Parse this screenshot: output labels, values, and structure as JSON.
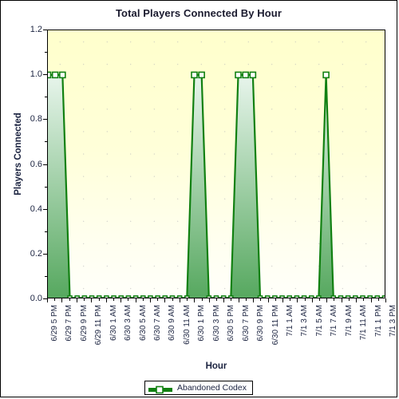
{
  "chart_data": {
    "type": "line",
    "title": "Total Players Connected By Hour",
    "xlabel": "Hour",
    "ylabel": "Players Connected",
    "ylim": [
      0.0,
      1.2
    ],
    "yticks": [
      "0.0",
      "0.2",
      "0.4",
      "0.6",
      "0.8",
      "1.0",
      "1.2"
    ],
    "ytick_values": [
      0.0,
      0.2,
      0.4,
      0.6,
      0.8,
      1.0,
      1.2
    ],
    "grid": true,
    "legend_position": "bottom",
    "categories": [
      "6/29 5 PM",
      "6/29 6 PM",
      "6/29 7 PM",
      "6/29 8 PM",
      "6/29 9 PM",
      "6/29 10 PM",
      "6/29 11 PM",
      "6/30 12 AM",
      "6/30 1 AM",
      "6/30 2 AM",
      "6/30 3 AM",
      "6/30 4 AM",
      "6/30 5 AM",
      "6/30 6 AM",
      "6/30 7 AM",
      "6/30 8 AM",
      "6/30 9 AM",
      "6/30 10 AM",
      "6/30 11 AM",
      "6/30 12 PM",
      "6/30 1 PM",
      "6/30 2 PM",
      "6/30 3 PM",
      "6/30 4 PM",
      "6/30 5 PM",
      "6/30 6 PM",
      "6/30 7 PM",
      "6/30 8 PM",
      "6/30 9 PM",
      "6/30 10 PM",
      "6/30 11 PM",
      "7/1 12 AM",
      "7/1 1 AM",
      "7/1 2 AM",
      "7/1 3 AM",
      "7/1 4 AM",
      "7/1 5 AM",
      "7/1 6 AM",
      "7/1 7 AM",
      "7/1 8 AM",
      "7/1 9 AM",
      "7/1 10 AM",
      "7/1 11 AM",
      "7/1 12 PM",
      "7/1 1 PM",
      "7/1 2 PM",
      "7/1 3 PM"
    ],
    "xtick_labels": [
      "6/29 5 PM",
      "6/29 7 PM",
      "6/29 9 PM",
      "6/29 11 PM",
      "6/30 1 AM",
      "6/30 3 AM",
      "6/30 5 AM",
      "6/30 7 AM",
      "6/30 9 AM",
      "6/30 11 AM",
      "6/30 1 PM",
      "6/30 3 PM",
      "6/30 5 PM",
      "6/30 7 PM",
      "6/30 9 PM",
      "6/30 11 PM",
      "7/1 1 AM",
      "7/1 3 AM",
      "7/1 5 AM",
      "7/1 7 AM",
      "7/1 9 AM",
      "7/1 11 AM",
      "7/1 1 PM",
      "7/1 3 PM"
    ],
    "xtick_indices": [
      0,
      2,
      4,
      6,
      8,
      10,
      12,
      14,
      16,
      18,
      20,
      22,
      24,
      26,
      28,
      30,
      32,
      34,
      36,
      38,
      40,
      42,
      44,
      46
    ],
    "series": [
      {
        "name": "Abandoned Codex",
        "color": "#118011",
        "fill_top": "#e8f5ec",
        "fill_bottom": "#56a85f",
        "marker": "square-open",
        "values": [
          1,
          1,
          1,
          0,
          0,
          0,
          0,
          0,
          0,
          0,
          0,
          0,
          0,
          0,
          0,
          0,
          0,
          0,
          0,
          0,
          1,
          1,
          0,
          0,
          0,
          0,
          1,
          1,
          1,
          0,
          0,
          0,
          0,
          0,
          0,
          0,
          0,
          0,
          1,
          0,
          0,
          0,
          0,
          0,
          0,
          0,
          0
        ]
      }
    ],
    "legend": [
      {
        "label": "Abandoned Codex",
        "color": "#118011"
      }
    ]
  }
}
